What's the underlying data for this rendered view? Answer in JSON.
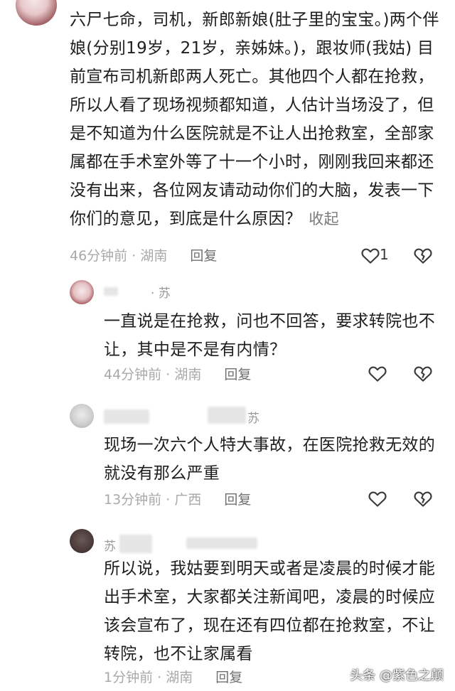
{
  "main_comment": {
    "text": "六尸七命，司机，新郎新娘(肚子里的宝宝。)两个伴娘(分别19岁，21岁，亲姊妹。)，跟妆师(我姑) 目前宣布司机新郎两人死亡。其他四个人都在抢救，所以人看了现场视频都知道，人估计当场没了，但是不知道为什么医院就是不让人出抢救室，全部家属都在手术室外等了十一个小时，刚刚我回来都还没有出来，各位网友请动动你们的大脑，发表一下你们的意见，到底是什么原因？",
    "collapse_label": "收起",
    "time": "46分钟前",
    "location": "湖南",
    "reply_label": "回复",
    "like_count": "1"
  },
  "replies": [
    {
      "username": "· 苏",
      "text": "一直说是在抢救，问也不回答，要求转院也不让，其中是不是有内情？",
      "time": "44分钟前",
      "location": "湖南",
      "reply_label": "回复"
    },
    {
      "username": "苏",
      "text": "现场一次六个人特大事故，在医院抢救无效的就没有那么严重",
      "time": "13分钟前",
      "location": "广西",
      "reply_label": "回复"
    },
    {
      "username": "苏",
      "text": "所以说，我姑要到明天或者是凌晨的时候才能出手术室，大家都关注新闻吧，凌晨的时候应该会宣布了，现在还有四位都在抢救室，不让转院，也不让家属看",
      "time": "1分钟前",
      "location": "湖南",
      "reply_label": "回复"
    }
  ],
  "separator": "·",
  "watermark": "头条 @紫色之颠",
  "icons": {
    "like": "heart-outline-icon",
    "dislike": "broken-heart-icon"
  }
}
